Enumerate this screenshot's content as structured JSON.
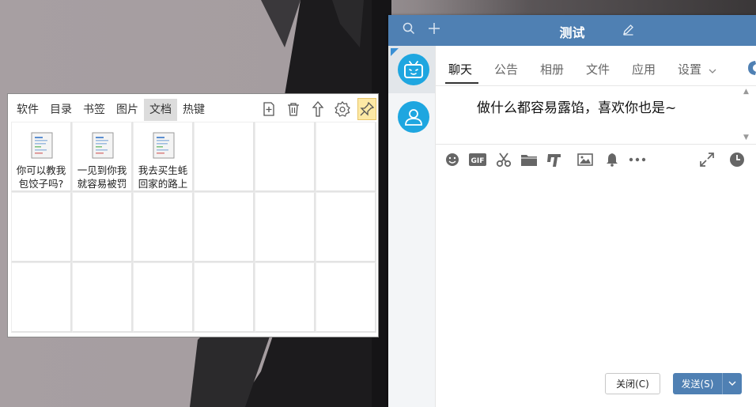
{
  "launcher": {
    "tabs": [
      "软件",
      "目录",
      "书签",
      "图片",
      "文档",
      "热键"
    ],
    "active_tab": "文档",
    "tools": [
      "add-icon",
      "trash-icon",
      "arrow-up-icon",
      "gear-icon",
      "pin-icon"
    ],
    "documents": [
      {
        "name": "你可以教我包饺子吗?"
      },
      {
        "name": "一见到你我就容易被罚"
      },
      {
        "name": "我去买生蚝回家的路上"
      }
    ]
  },
  "chat": {
    "title": "测试",
    "tabs": [
      "聊天",
      "公告",
      "相册",
      "文件",
      "应用",
      "设置"
    ],
    "active_tab": "聊天",
    "message": "做什么都容易露馅，喜欢你也是~",
    "toolbar_icons": [
      "emoji-icon",
      "gif-icon",
      "scissors-icon",
      "folder-icon",
      "music-icon",
      "image-icon",
      "bell-icon",
      "more-icon",
      "expand-icon",
      "history-icon"
    ],
    "close_label": "关闭(C)",
    "send_label": "发送(S)",
    "colors": {
      "accent": "#4f80b3",
      "avatar": "#1ea6e0"
    }
  }
}
